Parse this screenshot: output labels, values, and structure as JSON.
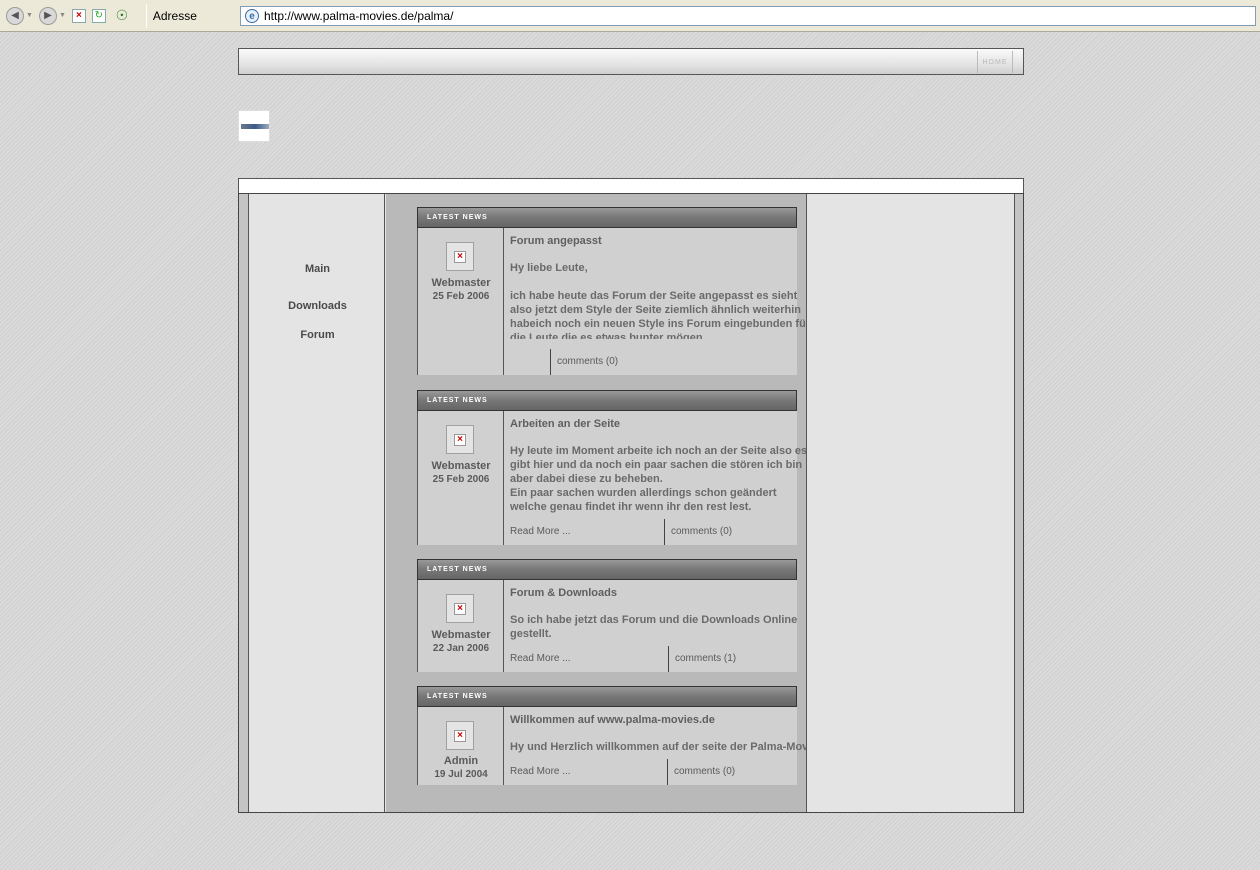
{
  "browser": {
    "address_label": "Adresse",
    "url": "http://www.palma-movies.de/palma/"
  },
  "header": {
    "home_link": "home"
  },
  "nav": {
    "items": [
      {
        "label": "Main"
      },
      {
        "label": "Downloads"
      },
      {
        "label": "Forum"
      }
    ]
  },
  "news": [
    {
      "header": "Latest News",
      "author": "Webmaster",
      "date": "25 Feb 2006",
      "title": "Forum angepasst",
      "text": "Hy liebe Leute,\n\nich habe heute das Forum der Seite angepasst es sieht\nalso jetzt dem Style der Seite ziemlich ähnlich weiterhin\nhabeich noch ein neuen Style ins Forum eingebunden für\ndie Leute die es etwas bunter mögen.",
      "read_more": "",
      "comments": "comments (0)"
    },
    {
      "header": "Latest News",
      "author": "Webmaster",
      "date": "25 Feb 2006",
      "title": "Arbeiten an der Seite",
      "text": "Hy leute im Moment arbeite ich noch an der Seite also es\ngibt hier und da noch ein paar sachen die stören ich bin\naber dabei diese zu beheben.\nEin paar sachen wurden allerdings schon geändert\nwelche genau findet ihr wenn ihr den rest lest.",
      "read_more": "Read More ...",
      "comments": "comments (0)"
    },
    {
      "header": "Latest News",
      "author": "Webmaster",
      "date": "22 Jan 2006",
      "title": "Forum & Downloads",
      "text": "So ich habe jetzt das Forum und die Downloads Online\ngestellt.",
      "read_more": "Read More ...",
      "comments": "comments (1)"
    },
    {
      "header": "Latest News",
      "author": "Admin",
      "date": "19 Jul 2004",
      "title": "Willkommen auf www.palma-movies.de",
      "text": "Hy und Herzlich willkommen auf der seite der Palma-Movies",
      "read_more": "Read More ...",
      "comments": "comments (0)"
    }
  ]
}
